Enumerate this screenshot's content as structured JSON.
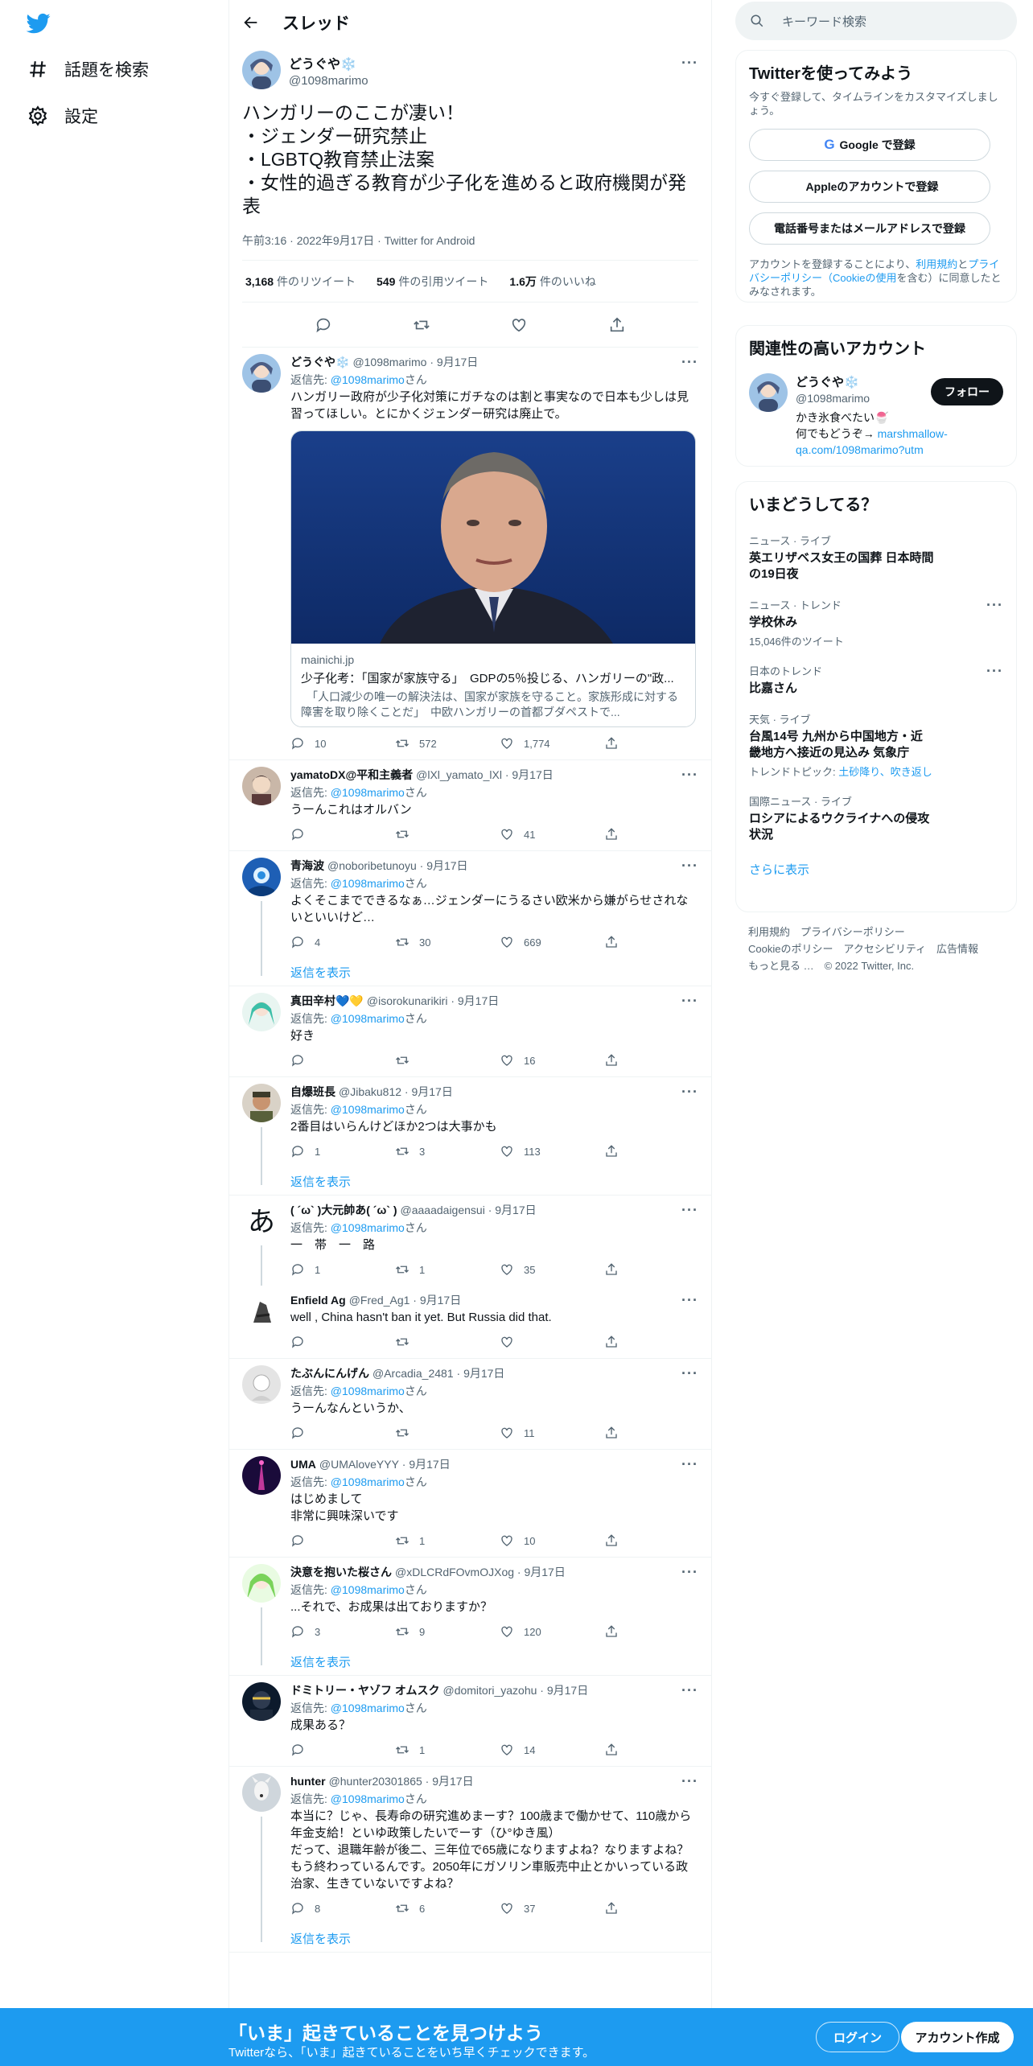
{
  "nav": {
    "explore": "話題を検索",
    "settings": "設定"
  },
  "header": {
    "title": "スレッド"
  },
  "main_tweet": {
    "name": "どうぐや❄️",
    "handle": "@1098marimo",
    "text": "ハンガリーのここが凄い！\n・ジェンダー研究禁止\n・LGBTQ教育禁止法案\n・女性的過ぎる教育が少子化を進めると政府機関が発表",
    "meta": "午前3:16 · 2022年9月17日 · Twitter for Android",
    "retweets": "3,168",
    "retweets_label": "件のリツイート",
    "quotes": "549",
    "quotes_label": "件の引用ツイート",
    "likes": "1.6万",
    "likes_label": "件のいいね"
  },
  "replying_prefix": "返信先: ",
  "replying_handle": "@1098marimo",
  "replying_suffix": "さん",
  "show_replies": "返信を表示",
  "replies": [
    {
      "name": "どうぐや❄️",
      "handle": "@1098marimo",
      "time": "· 9月17日",
      "text": "ハンガリー政府が少子化対策にガチなのは割と事実なので日本も少しは見習ってほしい。とにかくジェンダー研究は廃止で。",
      "reply": "10",
      "rt": "572",
      "like": "1,774"
    },
    {
      "name": "yamatoDX@平和主義者",
      "handle": "@lXl_yamato_lXl",
      "time": "· 9月17日",
      "text": "うーんこれはオルバン",
      "reply": "",
      "rt": "",
      "like": "41"
    },
    {
      "name": "青海波",
      "handle": "@noboribetunoyu",
      "time": "· 9月17日",
      "text": "よくそこまでできるなぁ…ジェンダーにうるさい欧米から嫌がらせされないといいけど…",
      "reply": "4",
      "rt": "30",
      "like": "669"
    },
    {
      "name": "真田辛村💙💛",
      "handle": "@isorokunarikiri",
      "time": "· 9月17日",
      "text": "好き",
      "reply": "",
      "rt": "",
      "like": "16"
    },
    {
      "name": "自爆班長",
      "handle": "@Jibaku812",
      "time": "· 9月17日",
      "text": "2番目はいらんけどほか2つは大事かも",
      "reply": "1",
      "rt": "3",
      "like": "113"
    },
    {
      "name": "( ´ω` )大元帥あ( ´ω` )",
      "handle": "@aaaadaigensui",
      "time": "· 9月17日",
      "text": "一　帯　一　路",
      "reply": "1",
      "rt": "1",
      "like": "35"
    },
    {
      "name": "Enfield Ag",
      "handle": "@Fred_Ag1",
      "time": "· 9月17日",
      "text": "well , China hasn't ban it yet. But Russia did that.",
      "reply": "",
      "rt": "",
      "like": ""
    },
    {
      "name": "たぶんにんげん",
      "handle": "@Arcadia_2481",
      "time": "· 9月17日",
      "text": "うーんなんというか、",
      "reply": "",
      "rt": "",
      "like": "11"
    },
    {
      "name": "UMA",
      "handle": "@UMAloveYYY",
      "time": "· 9月17日",
      "text": "はじめまして\n非常に興味深いです",
      "reply": "",
      "rt": "1",
      "like": "10"
    },
    {
      "name": "決意を抱いた桜さん",
      "handle": "@xDLCRdFOvmOJXog",
      "time": "· 9月17日",
      "text": "...それで、お成果は出ておりますか？",
      "reply": "3",
      "rt": "9",
      "like": "120"
    },
    {
      "name": "ドミトリー・ヤゾフ オムスク",
      "handle": "@domitori_yazohu",
      "time": "· 9月17日",
      "text": "成果ある？",
      "reply": "",
      "rt": "1",
      "like": "14"
    },
    {
      "name": "hunter",
      "handle": "@hunter20301865",
      "time": "· 9月17日",
      "text": "本当に？じゃ、長寿命の研究進めまーす？100歳まで働かせて、110歳から年金支給！といゆ政策したいでーす（ひ°ゆき風）\nだって、退職年齢が後二、三年位で65歳になりますよね？なりますよね？もう終わっているんです。2050年にガソリン車販売中止とかいっている政治家、生きていないですよね？",
      "reply": "8",
      "rt": "6",
      "like": "37"
    }
  ],
  "card": {
    "domain": "mainichi.jp",
    "title": "少子化考：「国家が家族守る」　GDPの5％投じる、ハンガリーの\"政...",
    "desc": "　「人口減少の唯一の解決法は、国家が家族を守ること。家族形成に対する障害を取り除くことだ」　中欧ハンガリーの首都ブダペストで..."
  },
  "right": {
    "search_placeholder": "キーワード検索",
    "signup_title": "Twitterを使ってみよう",
    "signup_sub": "今すぐ登録して、タイムラインをカスタマイズしましょう。",
    "google_btn": "Google で登録",
    "apple_btn": "Appleのアカウントで登録",
    "phone_btn": "電話番号またはメールアドレスで登録",
    "fine_1": "アカウントを登録することにより、",
    "fine_terms": "利用規約",
    "fine_2": "と",
    "fine_privacy": "プライバシーポリシー（Cookieの使用",
    "fine_3": "を含む）に同意したとみなされます。",
    "related_title": "関連性の高いアカウント",
    "related_name": "どうぐや❄️",
    "related_handle": "@1098marimo",
    "related_bio_1": "かき氷食べたい🍧",
    "related_bio_2": "何でもどうぞ→ ",
    "related_link": "marshmallow-qa.com/1098marimo?utm",
    "follow_btn": "フォロー",
    "trends_title": "いまどうしてる？",
    "trends": [
      {
        "ctx": "ニュース · ライブ",
        "title": "英エリザベス女王の国葬 日本時間の19日夜",
        "count": ""
      },
      {
        "ctx": "ニュース · トレンド",
        "title": "学校休み",
        "count": "15,046件のツイート"
      },
      {
        "ctx": "日本のトレンド",
        "title": "比嘉さん",
        "count": ""
      },
      {
        "ctx": "天気 · ライブ",
        "title": "台風14号 九州から中国地方・近畿地方へ接近の見込み 気象庁",
        "count": ""
      },
      {
        "ctx": "国際ニュース · ライブ",
        "title": "ロシアによるウクライナへの侵攻状況",
        "count": ""
      }
    ],
    "trend_topic_prefix": "トレンドトピック: ",
    "trend_topic_links": "土砂降り、吹き返し",
    "show_more": "さらに表示",
    "footer_1": "利用規約　プライバシーポリシー",
    "footer_2": "Cookieのポリシー　アクセシビリティ　広告情報",
    "footer_3": "もっと見る …　© 2022 Twitter, Inc."
  },
  "banner": {
    "title": "「いま」起きていることを見つけよう",
    "sub": "Twitterなら、「いま」起きていることをいち早くチェックできます。",
    "login": "ログイン",
    "signup": "アカウント作成"
  },
  "colors": {
    "accent": "#1d9bf0",
    "text": "#0f1419",
    "secondary": "#536471"
  }
}
